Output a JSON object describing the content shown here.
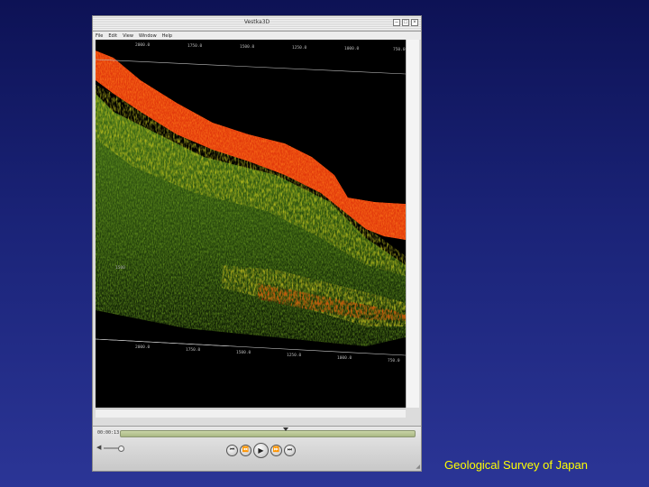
{
  "window": {
    "title": "Vestka3D",
    "menu": [
      "File",
      "Edit",
      "View",
      "Window",
      "Help"
    ],
    "buttons": [
      "–",
      "□",
      "×"
    ]
  },
  "seismic": {
    "top_ticks": [
      "2000.0",
      "1750.0",
      "1500.0",
      "1250.0",
      "1000.0",
      "750.0"
    ],
    "bottom_ticks": [
      "2000.0",
      "1750.0",
      "1500.0",
      "1250.0",
      "1000.0",
      "750.0"
    ],
    "left_label": "1500"
  },
  "player": {
    "timecode": "00:00:13",
    "progress": 0.56,
    "volume": 1.0,
    "controls": {
      "rewind_start": "⏮",
      "step_back": "⏪",
      "play": "▶",
      "step_forward": "⏩",
      "fast_forward_end": "⏭"
    },
    "speaker_icon": "speaker-icon"
  },
  "caption": "Geological Survey of Japan",
  "colors": {
    "background_top": "#0d1255",
    "background_bottom": "#2b3596",
    "caption": "#ffff00",
    "seismic_red": "#e0300a",
    "seismic_yellow": "#c8c81e",
    "seismic_green": "#2e5a10"
  }
}
